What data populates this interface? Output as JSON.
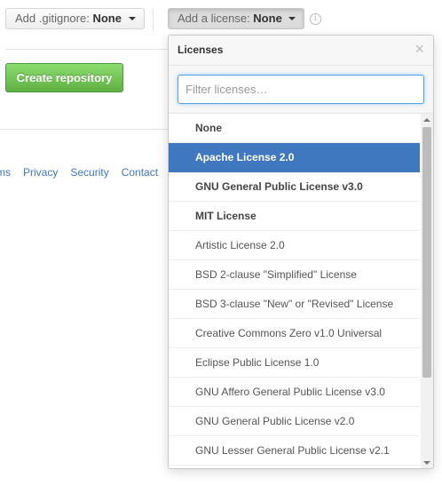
{
  "gitignore": {
    "label": "Add .gitignore:",
    "value": "None"
  },
  "license": {
    "label": "Add a license:",
    "value": "None"
  },
  "info_icon": "info-icon",
  "create_button": "Create repository",
  "footer_links": [
    "rms",
    "Privacy",
    "Security",
    "Contact"
  ],
  "dropdown": {
    "title": "Licenses",
    "close": "×",
    "filter_placeholder": "Filter licenses…",
    "filter_value": "",
    "items": [
      {
        "label": "None",
        "featured": true,
        "selected": false
      },
      {
        "label": "Apache License 2.0",
        "featured": true,
        "selected": true
      },
      {
        "label": "GNU General Public License v3.0",
        "featured": true,
        "selected": false
      },
      {
        "label": "MIT License",
        "featured": true,
        "selected": false
      },
      {
        "label": "Artistic License 2.0",
        "featured": false,
        "selected": false
      },
      {
        "label": "BSD 2-clause \"Simplified\" License",
        "featured": false,
        "selected": false
      },
      {
        "label": "BSD 3-clause \"New\" or \"Revised\" License",
        "featured": false,
        "selected": false
      },
      {
        "label": "Creative Commons Zero v1.0 Universal",
        "featured": false,
        "selected": false
      },
      {
        "label": "Eclipse Public License 1.0",
        "featured": false,
        "selected": false
      },
      {
        "label": "GNU Affero General Public License v3.0",
        "featured": false,
        "selected": false
      },
      {
        "label": "GNU General Public License v2.0",
        "featured": false,
        "selected": false
      },
      {
        "label": "GNU Lesser General Public License v2.1",
        "featured": false,
        "selected": false
      }
    ]
  },
  "colors": {
    "selected_bg": "#4078c0",
    "create_green": "#60b044",
    "link_blue": "#4078c0",
    "filter_focus": "#51a7e8"
  }
}
